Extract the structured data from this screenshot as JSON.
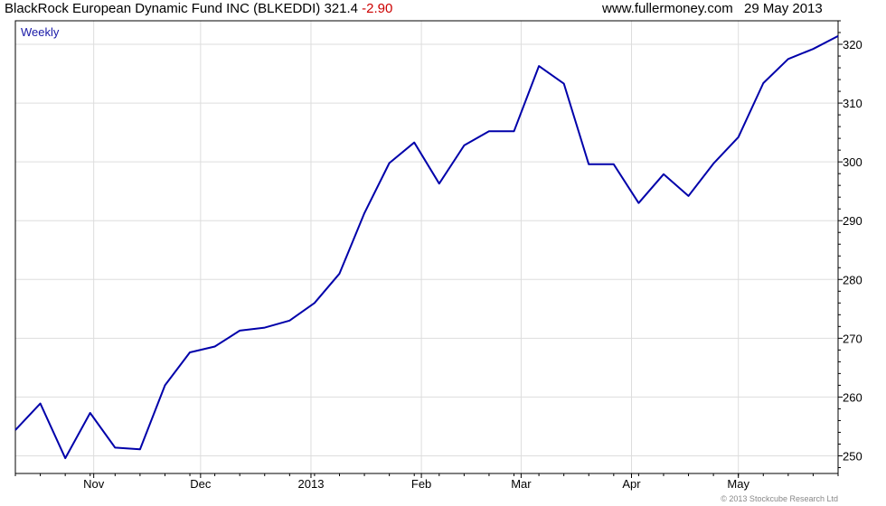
{
  "header": {
    "title": "BlackRock European Dynamic Fund INC (BLKEDDI) 321.4",
    "change": "-2.90",
    "site": "www.fullermoney.com",
    "date": "29 May 2013"
  },
  "chart_data": {
    "type": "line",
    "period_label": "Weekly",
    "copyright": "© 2013 Stockcube Research Ltd",
    "x_ticks": [
      "Nov",
      "Dec",
      "2013",
      "Feb",
      "Mar",
      "Apr",
      "May"
    ],
    "y_ticks": [
      250,
      260,
      270,
      280,
      290,
      300,
      310,
      320
    ],
    "ylim": [
      247,
      324
    ],
    "x": [
      "2012-10-10",
      "2012-10-17",
      "2012-10-24",
      "2012-10-31",
      "2012-11-07",
      "2012-11-14",
      "2012-11-21",
      "2012-11-28",
      "2012-12-05",
      "2012-12-12",
      "2012-12-19",
      "2012-12-26",
      "2013-01-02",
      "2013-01-09",
      "2013-01-16",
      "2013-01-23",
      "2013-01-30",
      "2013-02-06",
      "2013-02-13",
      "2013-02-20",
      "2013-02-27",
      "2013-03-06",
      "2013-03-13",
      "2013-03-20",
      "2013-03-27",
      "2013-04-03",
      "2013-04-10",
      "2013-04-17",
      "2013-04-24",
      "2013-05-01",
      "2013-05-08",
      "2013-05-15",
      "2013-05-22",
      "2013-05-29"
    ],
    "series": [
      {
        "color": "#0000aa",
        "values": [
          254.4,
          258.9,
          249.6,
          257.3,
          251.4,
          251.1,
          262.0,
          267.6,
          268.6,
          271.3,
          271.8,
          273.0,
          276.0,
          281.0,
          291.3,
          299.8,
          303.3,
          296.3,
          302.8,
          305.2,
          305.2,
          316.3,
          313.3,
          299.6,
          299.6,
          293.0,
          297.9,
          294.2,
          299.7,
          304.2,
          313.4,
          317.5,
          319.2,
          321.4
        ]
      }
    ],
    "colors": {
      "line": "#0000aa",
      "grid": "#dddddd",
      "axis": "#000000"
    }
  }
}
